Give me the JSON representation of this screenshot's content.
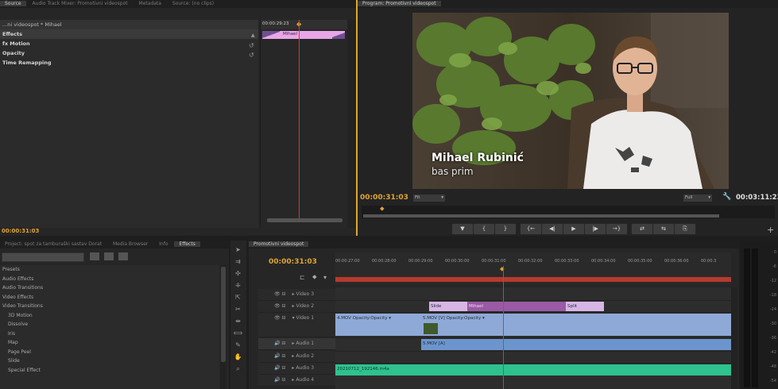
{
  "effect_controls": {
    "tabs": [
      "Source",
      "Audio Track Mixer: Promotivni videospot",
      "Metadata",
      "Source: (no clips)"
    ],
    "sequence_clip": "...ni videospot * Mihael",
    "timecode": "00:00:29:23",
    "clip_label": "Mihael",
    "rows": [
      {
        "label": "Effects",
        "bold": true
      },
      {
        "label": "fx Motion",
        "bold": true
      },
      {
        "label": "Opacity",
        "bold": true
      },
      {
        "label": "Time Remapping",
        "bold": true
      }
    ],
    "footer_timecode": "00:00:31:03"
  },
  "program_monitor": {
    "tab": "Program: Promotivni videospot",
    "name_title": "Mihael Rubinić",
    "name_subtitle": "bas prim",
    "current_time": "00:00:31:03",
    "fit_label": "Fit",
    "quality_label": "Full",
    "duration": "00:03:11:23",
    "transport": [
      "▼",
      "{",
      "}",
      "{←",
      "◀|",
      "▶",
      "|▶",
      "→}",
      "⇄",
      "⇆",
      "⎘"
    ]
  },
  "project_panel": {
    "tabs": [
      "Project: spot za tamburaški sastav Dorat",
      "Media Browser",
      "Info",
      "Effects"
    ],
    "effects": [
      "Presets",
      "Audio Effects",
      "Audio Transitions",
      "Video Effects",
      "Video Transitions",
      "3D Motion",
      "Dissolve",
      "Iris",
      "Map",
      "Page Peel",
      "Slide",
      "Special Effect"
    ]
  },
  "timeline": {
    "tab": "Promotivni videospot",
    "timecode": "00:00:31:03",
    "ruler": [
      "00:00:27:00",
      "00:00:28:00",
      "00:00:29:00",
      "00:00:30:00",
      "00:00:31:00",
      "00:00:32:00",
      "00:00:33:00",
      "00:00:34:00",
      "00:00:35:00",
      "00:00:36:00",
      "00:00:3"
    ],
    "tracks": [
      "Video 3",
      "Video 2",
      "Video 1",
      "Audio 1",
      "Audio 2",
      "Audio 3",
      "Audio 4"
    ],
    "clips": {
      "v2_slide": "Slide",
      "v2_mihael": "Mihael",
      "v2_split": "Split",
      "v1_a": "4.MOV  Opacity:Opacity ▾",
      "v1_b": "5.MOV [V]  Opacity:Opacity ▾",
      "a1": "5.MOV [A]",
      "a3": "20210712_192146.m4a"
    }
  },
  "vu_meter": {
    "labels": [
      "0",
      "-6",
      "-12",
      "-18",
      "-24",
      "-30",
      "-36",
      "-42",
      "-48",
      "-54"
    ]
  },
  "colors": {
    "accent": "#e0a530",
    "playhead": "#d93a2b",
    "video_clip": "#8fa9d6",
    "audio_clip": "#6b95cc",
    "audio3_clip": "#2ec28f",
    "title_clip": "#c6a0d8"
  }
}
